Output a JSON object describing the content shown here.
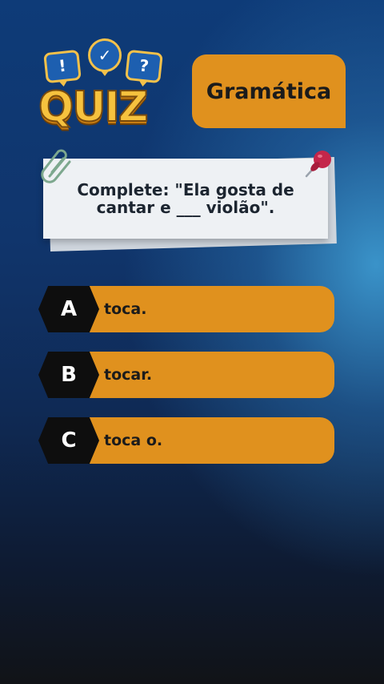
{
  "logo": {
    "word": "QUIZ",
    "bubbles": [
      "!",
      "✓",
      "?"
    ]
  },
  "category": {
    "label": "Gramática"
  },
  "question": {
    "text": "Complete: \"Ela gosta de cantar e ___ violão\"."
  },
  "options": [
    {
      "letter": "A",
      "text": "toca."
    },
    {
      "letter": "B",
      "text": "tocar."
    },
    {
      "letter": "C",
      "text": "toca o."
    }
  ],
  "icons": {
    "clip": "paperclip-icon",
    "pin": "pushpin-icon"
  },
  "colors": {
    "accent": "#e0911e",
    "hex": "#0e0e0e",
    "card": "#eef1f4",
    "logo": "#f6c23e"
  }
}
